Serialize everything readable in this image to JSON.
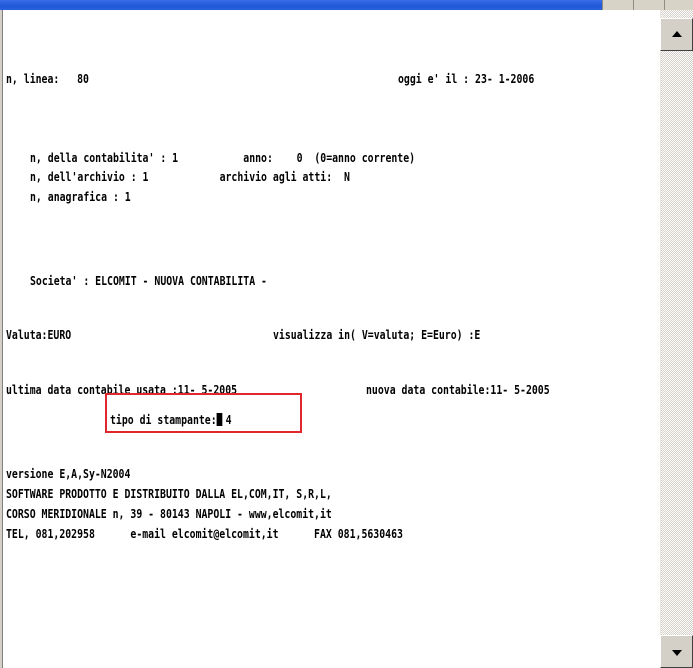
{
  "screen": {
    "row1_left": "n, linea:   80",
    "row1_right": "oggi e' il : 23- 1-2006",
    "contabilita": "n, della contabilita' : 1           anno:    0  (0=anno corrente)",
    "archivio": "n, dell'archivio : 1            archivio agli atti:  N",
    "anagrafica": "n, anagrafica : 1",
    "societa": "Societa' : ELCOMIT - NUOVA CONTABILITA -",
    "valuta_left": "Valuta:EURO",
    "valuta_right": "visualizza in( V=valuta; E=Euro) :E",
    "data_left": "ultima data contabile usata :11- 5-2005",
    "data_right": "nuova data contabile:11- 5-2005",
    "stampante_label": "tipo di stampante:",
    "stampante_value": "4",
    "versione": "versione E,A,Sy-N2004",
    "software": "SOFTWARE PRODOTTO E DISTRIBUITO DALLA EL,COM,IT, S,R,L,",
    "indirizzo": "CORSO MERIDIONALE n, 39 - 80143 NAPOLI - www,elcomit,it",
    "contatti": "TEL, 081,202958      e-mail elcomit@elcomit,it      FAX 081,5630463"
  },
  "colors": {
    "titlebar": "#1f57d6",
    "highlight": "#e0282c",
    "frame": "#d4d0c8"
  },
  "icons": {
    "scroll_up": "up-arrow-icon",
    "scroll_down": "down-arrow-icon"
  }
}
